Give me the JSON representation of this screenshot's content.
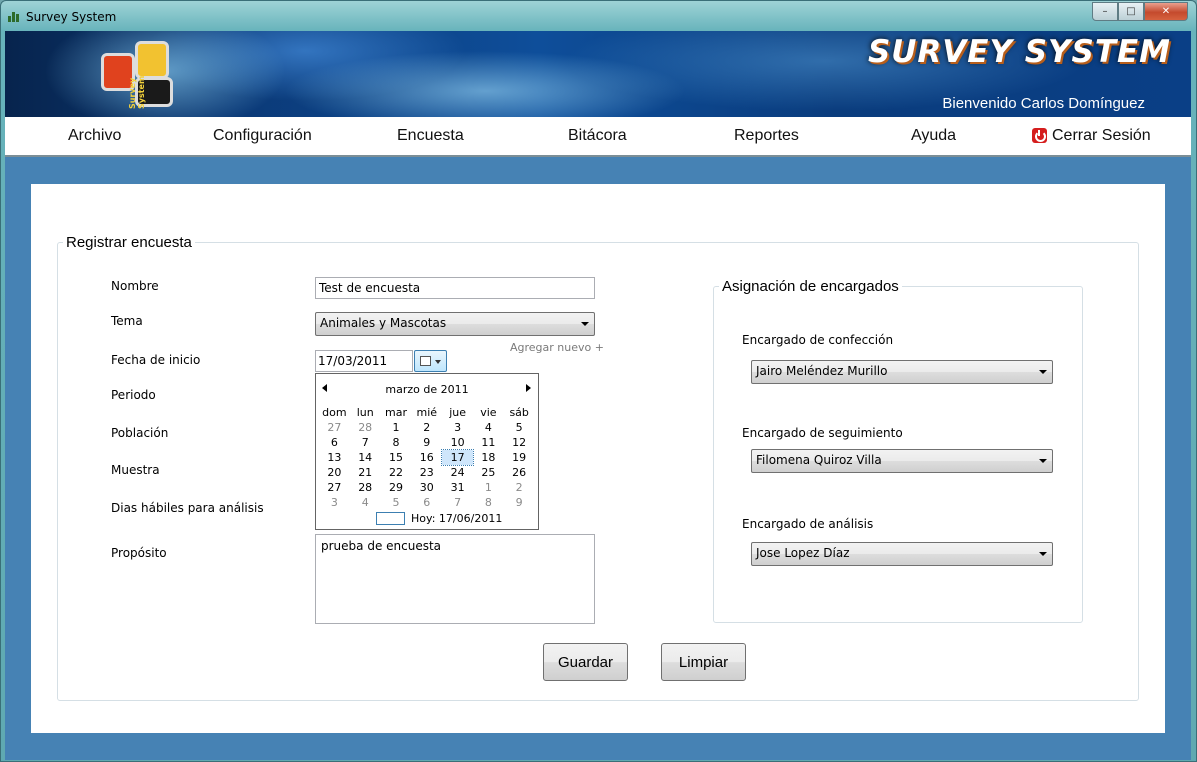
{
  "window": {
    "title": "Survey System",
    "buttons": {
      "minimize": "–",
      "maximize": "□",
      "close": "✕"
    }
  },
  "banner": {
    "logo_text": "Survey System",
    "title": "SURVEY SYSTEM",
    "welcome": "Bienvenido Carlos Domínguez"
  },
  "menu": {
    "items": [
      "Archivo",
      "Configuración",
      "Encuesta",
      "Bitácora",
      "Reportes",
      "Ayuda"
    ],
    "logout": "Cerrar Sesión"
  },
  "form": {
    "group_title": "Registrar encuesta",
    "labels": {
      "nombre": "Nombre",
      "tema": "Tema",
      "fecha_inicio": "Fecha de inicio",
      "periodo": "Periodo",
      "poblacion": "Población",
      "muestra": "Muestra",
      "dias_habiles": "Dias hábiles para análisis",
      "proposito": "Propósito"
    },
    "nombre_value": "Test de encuesta",
    "tema_value": "Animales y Mascotas",
    "agregar_nuevo": "Agregar nuevo +",
    "fecha_value": "17/03/2011",
    "proposito_value": "prueba de encuesta",
    "guardar": "Guardar",
    "limpiar": "Limpiar"
  },
  "calendar": {
    "month_title": "marzo de 2011",
    "days_of_week": [
      "dom",
      "lun",
      "mar",
      "mié",
      "jue",
      "vie",
      "sáb"
    ],
    "weeks": [
      [
        "27",
        "28",
        "1",
        "2",
        "3",
        "4",
        "5"
      ],
      [
        "6",
        "7",
        "8",
        "9",
        "10",
        "11",
        "12"
      ],
      [
        "13",
        "14",
        "15",
        "16",
        "17",
        "18",
        "19"
      ],
      [
        "20",
        "21",
        "22",
        "23",
        "24",
        "25",
        "26"
      ],
      [
        "27",
        "28",
        "29",
        "30",
        "31",
        "1",
        "2"
      ],
      [
        "3",
        "4",
        "5",
        "6",
        "7",
        "8",
        "9"
      ]
    ],
    "selected_day": "17",
    "today_label": "Hoy: 17/06/2011"
  },
  "assign": {
    "group_title": "Asignación de encargados",
    "confeccion_label": "Encargado de confección",
    "confeccion_value": "Jairo Meléndez Murillo",
    "seguimiento_label": "Encargado de seguimiento",
    "seguimiento_value": "Filomena Quiroz Villa",
    "analisis_label": "Encargado de análisis",
    "analisis_value": "Jose Lopez Díaz"
  }
}
